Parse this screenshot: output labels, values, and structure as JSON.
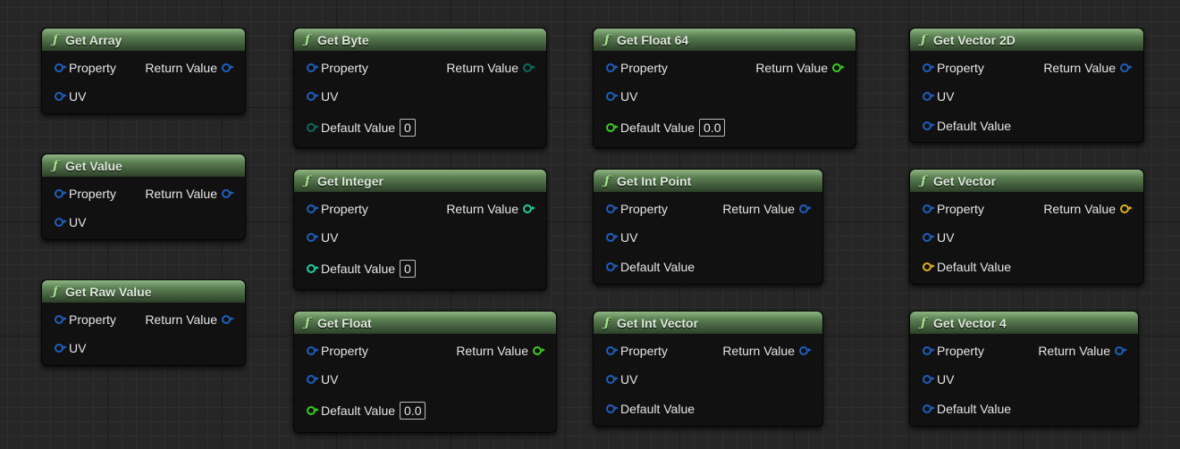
{
  "colors": {
    "struct": "#1f5fc0",
    "byte": "#0d6a5e",
    "integer": "#1fcfa0",
    "float": "#3ccf1a",
    "vector": "#e0b020"
  },
  "nodes": [
    {
      "title": "Get Array",
      "icon": "function-icon",
      "return_label": "Return Value",
      "return_pin": "struct",
      "inputs": [
        {
          "label": "Property",
          "pin": "struct"
        },
        {
          "label": "UV",
          "pin": "struct"
        }
      ]
    },
    {
      "title": "Get Value",
      "icon": "function-icon",
      "return_label": "Return Value",
      "return_pin": "struct",
      "inputs": [
        {
          "label": "Property",
          "pin": "struct"
        },
        {
          "label": "UV",
          "pin": "struct"
        }
      ]
    },
    {
      "title": "Get Raw Value",
      "icon": "function-icon",
      "return_label": "Return Value",
      "return_pin": "struct",
      "inputs": [
        {
          "label": "Property",
          "pin": "struct"
        },
        {
          "label": "UV",
          "pin": "struct"
        }
      ]
    },
    {
      "title": "Get Byte",
      "icon": "function-icon",
      "return_label": "Return Value",
      "return_pin": "byte",
      "inputs": [
        {
          "label": "Property",
          "pin": "struct"
        },
        {
          "label": "UV",
          "pin": "struct"
        },
        {
          "label": "Default Value",
          "pin": "byte",
          "value": "0"
        }
      ]
    },
    {
      "title": "Get Integer",
      "icon": "function-icon",
      "return_label": "Return Value",
      "return_pin": "integer",
      "inputs": [
        {
          "label": "Property",
          "pin": "struct"
        },
        {
          "label": "UV",
          "pin": "struct"
        },
        {
          "label": "Default Value",
          "pin": "integer",
          "value": "0"
        }
      ]
    },
    {
      "title": "Get Float",
      "icon": "function-icon",
      "return_label": "Return Value",
      "return_pin": "float",
      "inputs": [
        {
          "label": "Property",
          "pin": "struct"
        },
        {
          "label": "UV",
          "pin": "struct"
        },
        {
          "label": "Default Value",
          "pin": "float",
          "value": "0.0"
        }
      ]
    },
    {
      "title": "Get Float 64",
      "icon": "function-icon",
      "return_label": "Return Value",
      "return_pin": "float",
      "inputs": [
        {
          "label": "Property",
          "pin": "struct"
        },
        {
          "label": "UV",
          "pin": "struct"
        },
        {
          "label": "Default Value",
          "pin": "float",
          "value": "0.0"
        }
      ]
    },
    {
      "title": "Get Int Point",
      "icon": "function-icon",
      "return_label": "Return Value",
      "return_pin": "struct",
      "inputs": [
        {
          "label": "Property",
          "pin": "struct"
        },
        {
          "label": "UV",
          "pin": "struct"
        },
        {
          "label": "Default Value",
          "pin": "struct"
        }
      ]
    },
    {
      "title": "Get Int Vector",
      "icon": "function-icon",
      "return_label": "Return Value",
      "return_pin": "struct",
      "inputs": [
        {
          "label": "Property",
          "pin": "struct"
        },
        {
          "label": "UV",
          "pin": "struct"
        },
        {
          "label": "Default Value",
          "pin": "struct"
        }
      ]
    },
    {
      "title": "Get Vector 2D",
      "icon": "function-icon",
      "return_label": "Return Value",
      "return_pin": "struct",
      "inputs": [
        {
          "label": "Property",
          "pin": "struct"
        },
        {
          "label": "UV",
          "pin": "struct"
        },
        {
          "label": "Default Value",
          "pin": "struct"
        }
      ]
    },
    {
      "title": "Get Vector",
      "icon": "function-icon",
      "return_label": "Return Value",
      "return_pin": "vector",
      "inputs": [
        {
          "label": "Property",
          "pin": "struct"
        },
        {
          "label": "UV",
          "pin": "struct"
        },
        {
          "label": "Default Value",
          "pin": "vector"
        }
      ]
    },
    {
      "title": "Get Vector 4",
      "icon": "function-icon",
      "return_label": "Return Value",
      "return_pin": "struct",
      "inputs": [
        {
          "label": "Property",
          "pin": "struct"
        },
        {
          "label": "UV",
          "pin": "struct"
        },
        {
          "label": "Default Value",
          "pin": "struct"
        }
      ]
    }
  ]
}
